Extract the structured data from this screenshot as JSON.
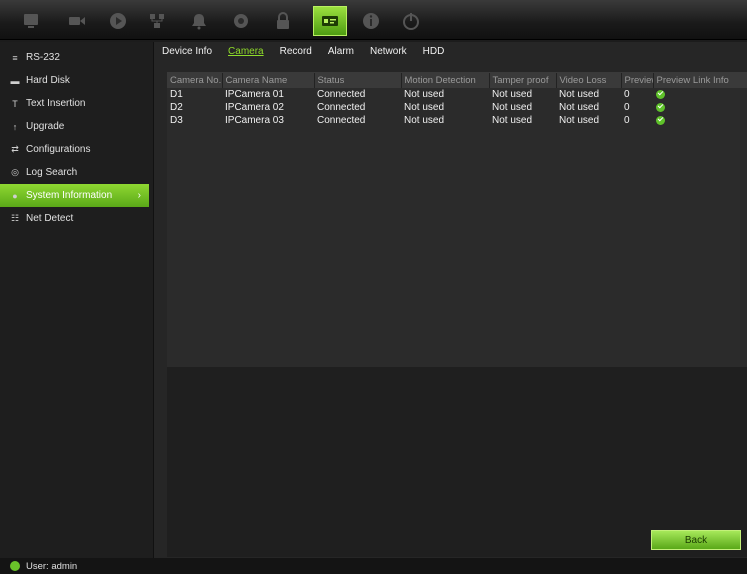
{
  "toolbar": {
    "icons": [
      "monitor-icon",
      "camera-icon",
      "playback-icon",
      "network-icon",
      "alarm-icon",
      "recording-icon",
      "user-lock-icon",
      "device-management-icon",
      "info-icon",
      "power-icon"
    ],
    "active_index": 7,
    "accent": "#6bbf1f"
  },
  "sidebar": {
    "items": [
      {
        "label": "RS-232",
        "icon": "serial-port-icon"
      },
      {
        "label": "Hard Disk",
        "icon": "hard-disk-icon"
      },
      {
        "label": "Text Insertion",
        "icon": "text-insertion-icon"
      },
      {
        "label": "Upgrade",
        "icon": "upgrade-icon"
      },
      {
        "label": "Configurations",
        "icon": "configurations-icon"
      },
      {
        "label": "Log Search",
        "icon": "log-search-icon"
      },
      {
        "label": "System Information",
        "icon": "system-info-icon",
        "active": true
      },
      {
        "label": "Net Detect",
        "icon": "net-detect-icon"
      }
    ]
  },
  "tabs": [
    {
      "label": "Device Info"
    },
    {
      "label": "Camera",
      "active": true
    },
    {
      "label": "Record"
    },
    {
      "label": "Alarm"
    },
    {
      "label": "Network"
    },
    {
      "label": "HDD"
    }
  ],
  "table": {
    "headers": [
      "Camera No.",
      "Camera Name",
      "Status",
      "Motion Detection",
      "Tamper proof",
      "Video Loss",
      "Preview",
      "Preview Link Info"
    ],
    "rows": [
      [
        "D1",
        "IPCamera 01",
        "Connected",
        "Not used",
        "Not used",
        "Not used",
        "0",
        "ok"
      ],
      [
        "D2",
        "IPCamera 02",
        "Connected",
        "Not used",
        "Not used",
        "Not used",
        "0",
        "ok"
      ],
      [
        "D3",
        "IPCamera 03",
        "Connected",
        "Not used",
        "Not used",
        "Not used",
        "0",
        "ok"
      ]
    ]
  },
  "buttons": {
    "back": "Back"
  },
  "status": {
    "user": "User: admin"
  }
}
